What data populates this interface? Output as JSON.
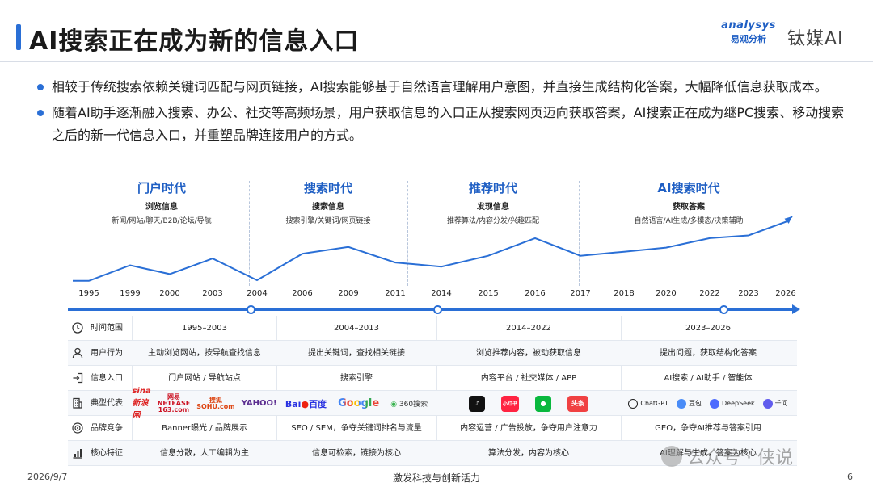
{
  "header": {
    "title": "AI搜索正在成为新的信息入口",
    "logo_analysys": "analysys",
    "logo_analysys_cn": "易观分析",
    "logo_partner": "钛媒AI"
  },
  "bullets": [
    "相较于传统搜索依赖关键词匹配与网页链接，AI搜索能够基于自然语言理解用户意图，并直接生成结构化答案，大幅降低信息获取成本。",
    "随着AI助手逐渐融入搜索、办公、社交等高频场景，用户获取信息的入口正从搜索网页迈向获取答案，AI搜索正在成为继PC搜索、移动搜索之后的新一代信息入口，并重塑品牌连接用户的方式。"
  ],
  "eras": [
    {
      "title": "门户时代",
      "subtitle": "浏览信息",
      "keywords": "新闻/网站/聊天/B2B/论坛/导航"
    },
    {
      "title": "搜索时代",
      "subtitle": "搜索信息",
      "keywords": "搜索引擎/关键词/网页链接"
    },
    {
      "title": "推荐时代",
      "subtitle": "发现信息",
      "keywords": "推荐算法/内容分发/兴趣匹配"
    },
    {
      "title": "AI搜索时代",
      "subtitle": "获取答案",
      "keywords": "自然语言/AI生成/多模态/决策辅助"
    }
  ],
  "trend": {
    "years": [
      "1995",
      "1999",
      "2000",
      "2003",
      "2004",
      "2006",
      "2009",
      "2011",
      "2014",
      "2015",
      "2016",
      "2017",
      "2018",
      "2020",
      "2022",
      "2023",
      "2026"
    ],
    "levels": [
      0.05,
      0.28,
      0.15,
      0.38,
      0.06,
      0.45,
      0.55,
      0.32,
      0.26,
      0.42,
      0.68,
      0.42,
      0.48,
      0.54,
      0.68,
      0.72,
      0.92
    ]
  },
  "table": {
    "rows": [
      {
        "icon": "clock-icon",
        "label": "时间范围",
        "cells": [
          "1995–2003",
          "2004–2013",
          "2014–2022",
          "2023–2026"
        ]
      },
      {
        "icon": "user-icon",
        "label": "用户行为",
        "cells": [
          "主动浏览网站，按导航查找信息",
          "提出关键词，查找相关链接",
          "浏览推荐内容，被动获取信息",
          "提出问题，获取结构化答案"
        ]
      },
      {
        "icon": "entrance-icon",
        "label": "信息入口",
        "cells": [
          "门户网站 / 导航站点",
          "搜索引擎",
          "内容平台 / 社交媒体 / APP",
          "AI搜索 / AI助手 / 智能体"
        ]
      },
      {
        "icon": "building-icon",
        "label": "典型代表",
        "cells": [
          "",
          "",
          "",
          ""
        ]
      },
      {
        "icon": "target-icon",
        "label": "品牌竞争",
        "cells": [
          "Banner曝光 / 品牌展示",
          "SEO / SEM，争夺关键词排名与流量",
          "内容运营 / 广告投放，争夺用户注意力",
          "GEO，争夺AI推荐与答案引用"
        ]
      },
      {
        "icon": "bar-chart-icon",
        "label": "核心特征",
        "cells": [
          "信息分散，人工编辑为主",
          "信息可检索，链接为核心",
          "算法分发，内容为核心",
          "AI理解与生成，答案为核心"
        ]
      }
    ],
    "brands": {
      "portal": [
        "sina新浪网",
        "网易",
        "NETEASE",
        "163.com",
        "搜狐",
        "SOHU.com",
        "YAHOO!"
      ],
      "search": [
        "Bai",
        "百度",
        "Google",
        "360搜索"
      ],
      "recommend": [
        "抖音",
        "小红书",
        "微信",
        "头条"
      ],
      "ai": [
        "ChatGPT",
        "豆包",
        "DeepSeek",
        "千问"
      ]
    }
  },
  "footer": {
    "date": "2026/9/7",
    "slogan": "激发科技与创新活力",
    "page": "6",
    "watermark": "公众号 · 侠说"
  },
  "colors": {
    "accent": "#2a6fd6",
    "era_title": "#1f5fc4"
  }
}
